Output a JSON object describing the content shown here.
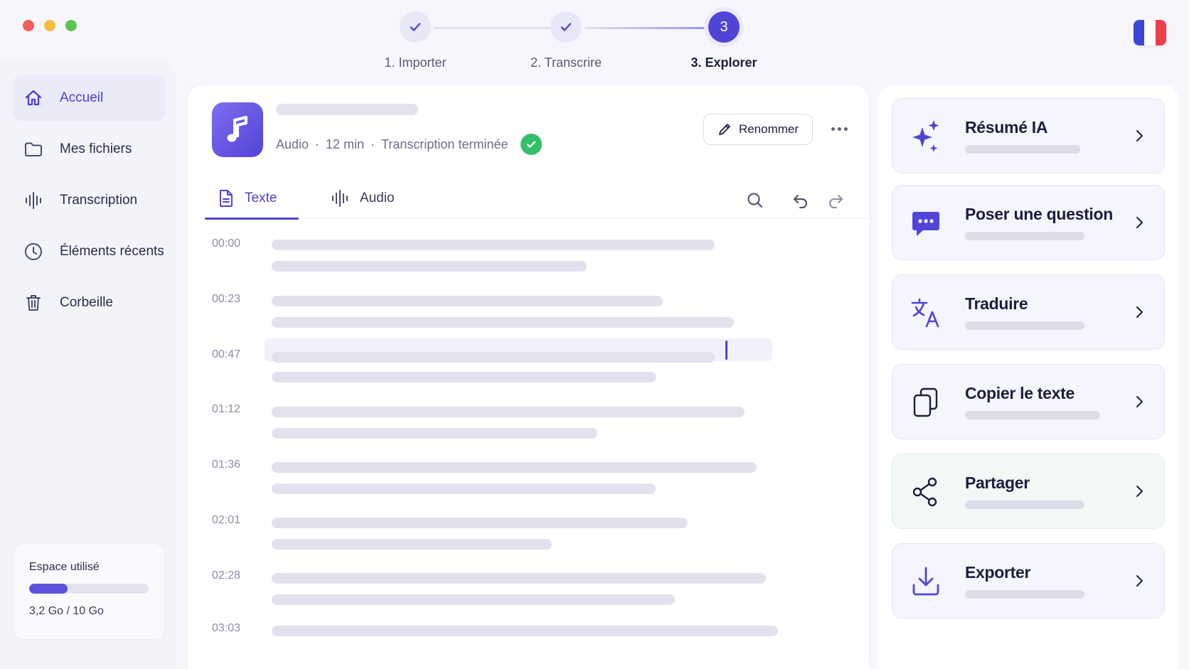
{
  "stepper": {
    "steps": [
      {
        "label": "1. Importer",
        "state": "done"
      },
      {
        "label": "2. Transcrire",
        "state": "done"
      },
      {
        "number": "3",
        "label": "3. Explorer",
        "state": "active"
      }
    ]
  },
  "sidebar": {
    "items": [
      {
        "label": "Accueil",
        "icon": "home-icon",
        "active": true
      },
      {
        "label": "Mes fichiers",
        "icon": "folder-icon"
      },
      {
        "label": "Transcription",
        "icon": "waveform-icon"
      },
      {
        "label": "Éléments récents",
        "icon": "clock-icon"
      },
      {
        "label": "Corbeille",
        "icon": "trash-icon"
      }
    ],
    "storage": {
      "title": "Espace utilisé",
      "usage": "3,2 Go / 10 Go",
      "used_fraction": 0.32
    }
  },
  "file": {
    "type": "Audio",
    "duration": "12 min",
    "separator": "·",
    "status": "Transcription terminée",
    "rename_label": "Renommer"
  },
  "tabs": [
    {
      "label": "Texte",
      "icon": "document-icon",
      "active": true
    },
    {
      "label": "Audio",
      "icon": "waveform-icon",
      "active": false
    }
  ],
  "transcript": {
    "timestamps": [
      "00:00",
      "00:23",
      "00:47",
      "01:12",
      "01:36",
      "02:01",
      "02:28",
      "03:03"
    ]
  },
  "actions": [
    {
      "label": "Résumé IA",
      "icon": "sparkles-icon"
    },
    {
      "label": "Poser une question",
      "icon": "chat-bubble-icon"
    },
    {
      "label": "Traduire",
      "icon": "translate-icon"
    },
    {
      "label": "Copier le texte",
      "icon": "copy-icon"
    },
    {
      "label": "Partager",
      "icon": "share-icon"
    },
    {
      "label": "Exporter",
      "icon": "download-icon"
    }
  ],
  "colors": {
    "accent": "#5145d8",
    "success": "#34c06b",
    "close": "#ee5f57",
    "minimize": "#f5bd3d",
    "zoom": "#5bc453",
    "flag_blue": "#3a47d6",
    "flag_white": "#ffffff",
    "flag_red": "#ee3f4a"
  }
}
